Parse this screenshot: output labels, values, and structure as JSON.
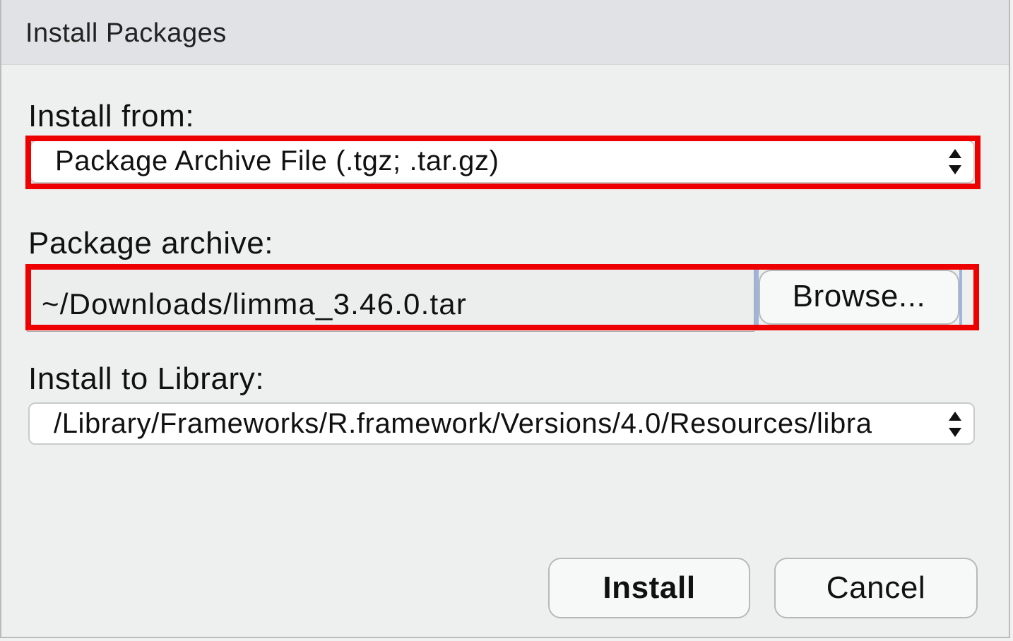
{
  "dialog": {
    "title": "Install Packages"
  },
  "install_from": {
    "label": "Install from:",
    "selected": "Package Archive File (.tgz; .tar.gz)"
  },
  "package_archive": {
    "label": "Package archive:",
    "value": "~/Downloads/limma_3.46.0.tar",
    "browse_label": "Browse..."
  },
  "install_to_library": {
    "label": "Install to Library:",
    "selected": "/Library/Frameworks/R.framework/Versions/4.0/Resources/libra"
  },
  "actions": {
    "install_label": "Install",
    "cancel_label": "Cancel"
  },
  "colors": {
    "highlight": "#ee0000",
    "background": "#eef0ef",
    "titlebar": "#e0e2e5"
  },
  "icons": {
    "select_arrows": "up-down-chevron-icon"
  }
}
